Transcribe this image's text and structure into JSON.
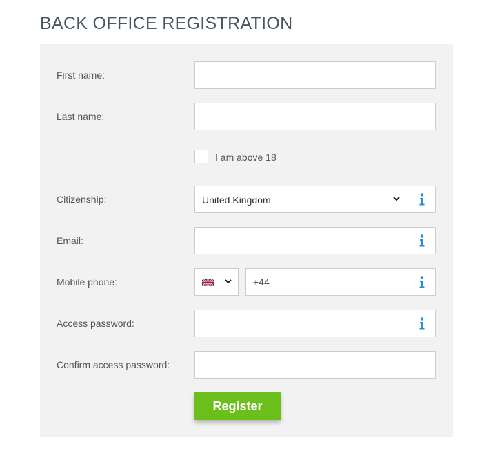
{
  "page": {
    "title": "BACK OFFICE REGISTRATION"
  },
  "form": {
    "first_name": {
      "label": "First name:",
      "value": ""
    },
    "last_name": {
      "label": "Last name:",
      "value": ""
    },
    "age_check": {
      "label": "I am above 18",
      "checked": false
    },
    "citizenship": {
      "label": "Citizenship:",
      "selected": "United Kingdom"
    },
    "email": {
      "label": "Email:",
      "value": ""
    },
    "mobile_phone": {
      "label": "Mobile phone:",
      "country_flag": "uk-flag-icon",
      "value": "+44"
    },
    "access_password": {
      "label": "Access password:",
      "value": ""
    },
    "confirm_password": {
      "label": "Confirm access password:",
      "value": ""
    },
    "register_label": "Register"
  },
  "colors": {
    "panel_bg": "#f2f2f2",
    "title": "#4a5660",
    "info_icon": "#2a8fd0",
    "register_bg": "#6cbf1b"
  },
  "icons": {
    "info": "info-icon",
    "dropdown": "chevron-down-icon"
  }
}
